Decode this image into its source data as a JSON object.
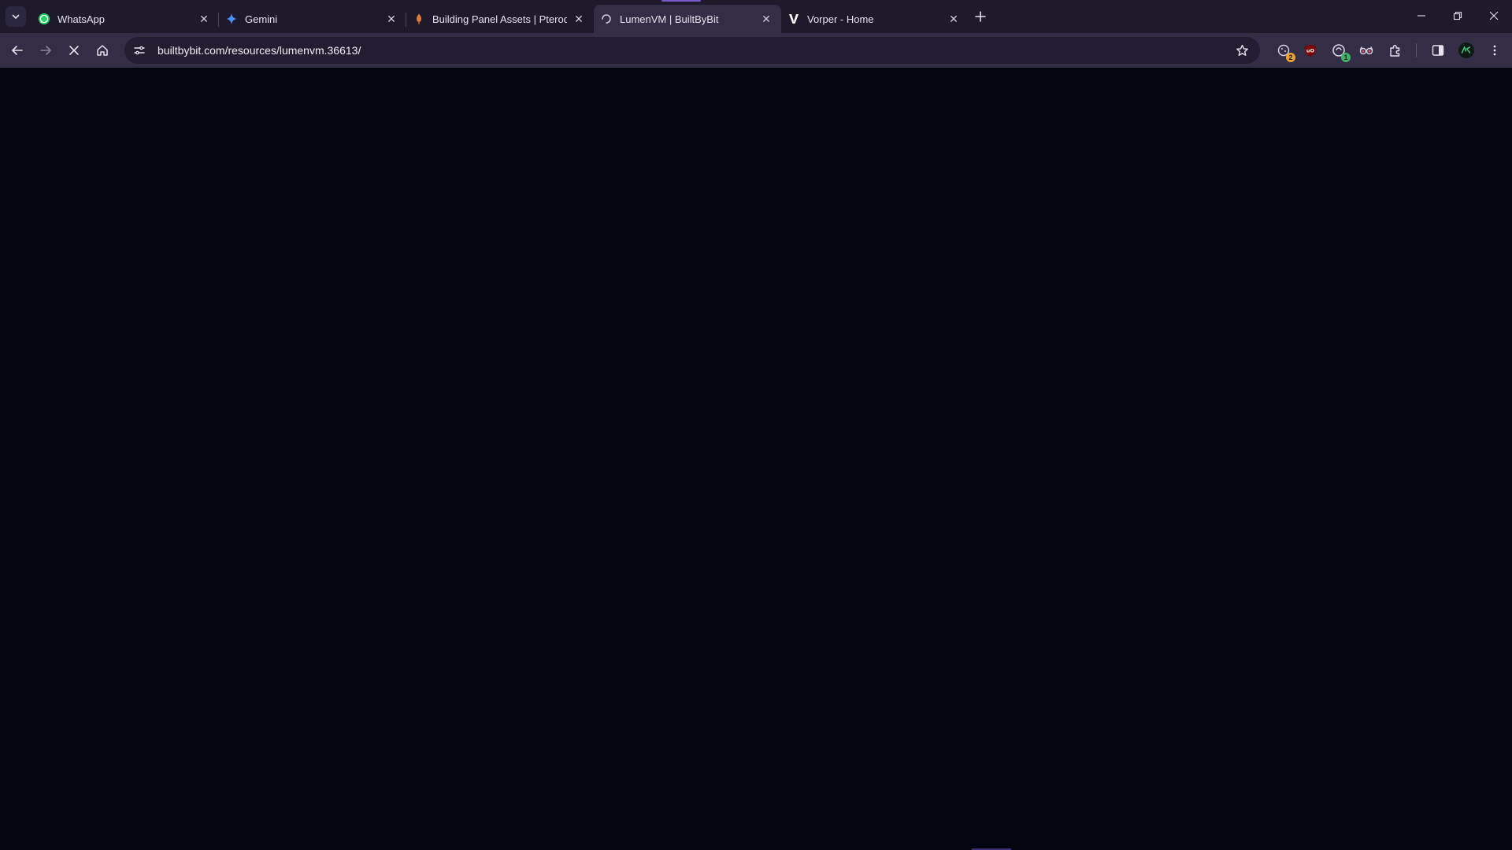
{
  "browser": {
    "tabs": [
      {
        "title": "WhatsApp",
        "icon": "whatsapp-icon",
        "active": false
      },
      {
        "title": "Gemini",
        "icon": "gemini-icon",
        "active": false
      },
      {
        "title": "Building Panel Assets | Pterodac",
        "icon": "pterodactyl-icon",
        "active": false
      },
      {
        "title": "LumenVM | BuiltByBit",
        "icon": "loading-spinner-icon",
        "active": true
      },
      {
        "title": "Vorper - Home",
        "icon": "vorper-logo-icon",
        "active": false
      }
    ],
    "address_bar": {
      "url": "builtbybit.com/resources/lumenvm.36613/"
    },
    "extensions": [
      {
        "name": "cookie-extension-icon",
        "badge": "2",
        "badge_color": "#f0a030"
      },
      {
        "name": "ublock-origin-icon",
        "badge": ""
      },
      {
        "name": "chat-extension-icon",
        "badge": "1",
        "badge_color": "#3fb36a"
      },
      {
        "name": "glasses-extension-icon",
        "badge": ""
      }
    ],
    "colors": {
      "tabstrip": "#1e1a2c",
      "toolbar": "#332d46",
      "page_background": "#020510",
      "accent": "#7a5cd0"
    }
  }
}
